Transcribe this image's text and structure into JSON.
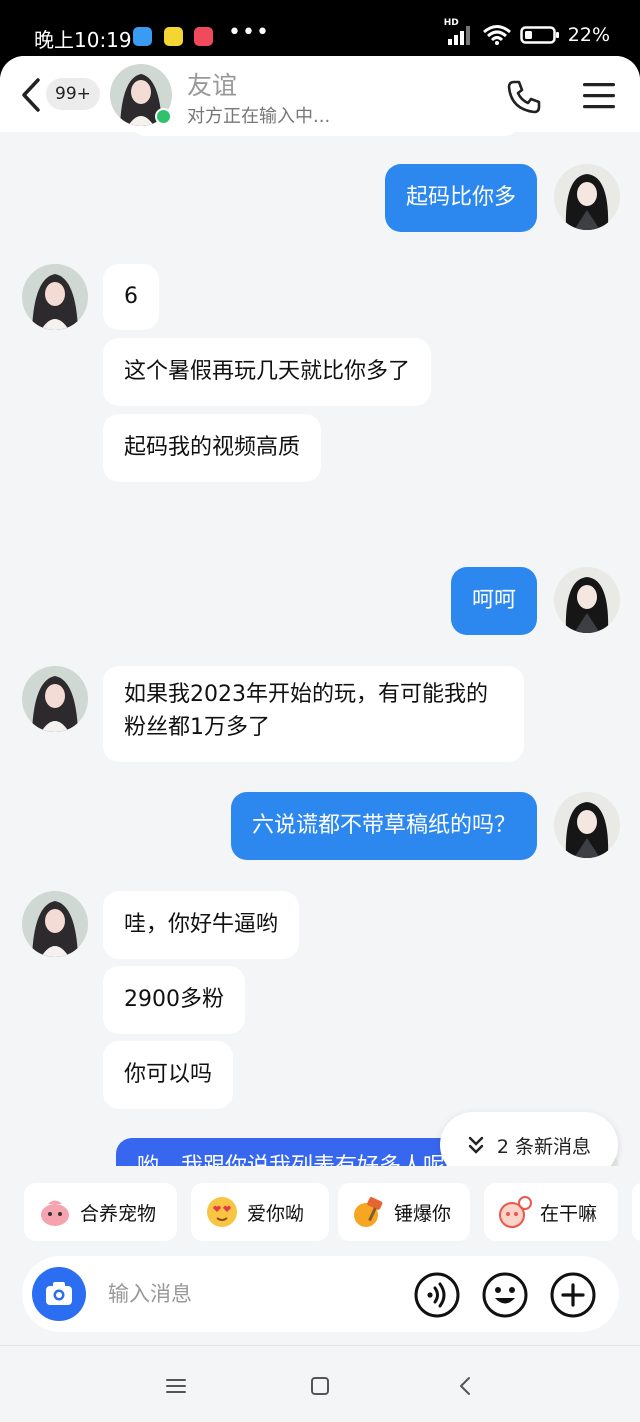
{
  "status_bar": {
    "time": "晚上10:19",
    "dots": "•••",
    "network": "HD",
    "battery": "22%"
  },
  "header": {
    "unread_count": "99+",
    "contact_name": "友谊",
    "contact_status": "对方正在输入中..."
  },
  "messages": [
    {
      "side": "out",
      "text": "起码比你多"
    },
    {
      "side": "in",
      "text": "6"
    },
    {
      "side": "in",
      "text": "这个暑假再玩几天就比你多了"
    },
    {
      "side": "in",
      "text": "起码我的视频高质"
    },
    {
      "side": "out",
      "text": "呵呵"
    },
    {
      "side": "in",
      "text": "如果我2023年开始的玩，有可能我的粉丝都1万多了"
    },
    {
      "side": "out",
      "text": "六说谎都不带草稿纸的吗？"
    },
    {
      "side": "in",
      "text": "哇，你好牛逼哟"
    },
    {
      "side": "in",
      "text": "2900多粉"
    },
    {
      "side": "in",
      "text": "你可以吗"
    },
    {
      "side": "out",
      "text": "哟，我跟你说我列表有好多人呢哦"
    }
  ],
  "new_messages": "2 条新消息",
  "quick_replies": [
    {
      "label": "合养宠物",
      "icon": "pet-icon"
    },
    {
      "label": "爱你呦",
      "icon": "love-face-icon"
    },
    {
      "label": "锤爆你",
      "icon": "hammer-icon"
    },
    {
      "label": "在干嘛",
      "icon": "question-face-icon"
    }
  ],
  "input": {
    "placeholder": "输入消息"
  },
  "colors": {
    "outgoing_bubble": "#2c88ef",
    "incoming_bubble": "#ffffff",
    "accent": "#2b6ef2",
    "online": "#2fc26a"
  }
}
